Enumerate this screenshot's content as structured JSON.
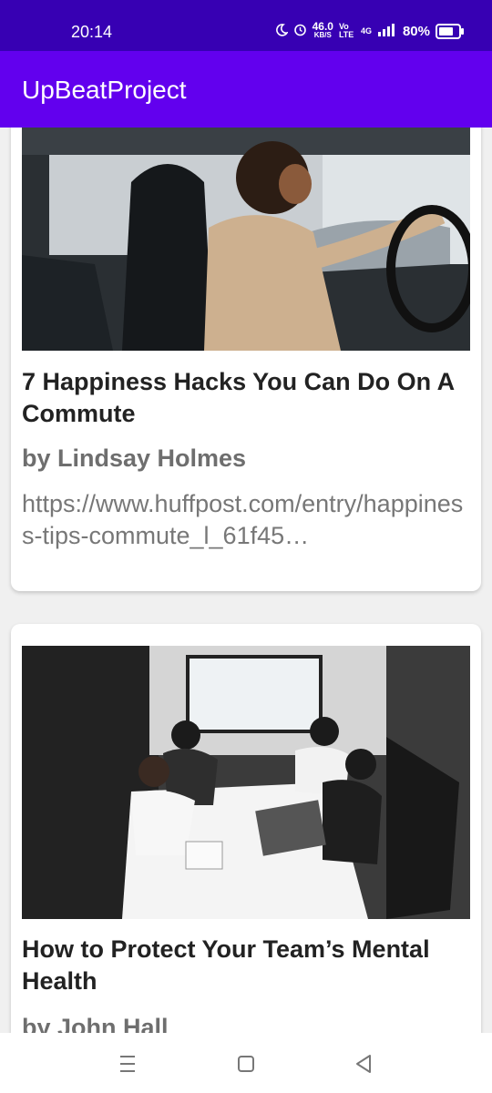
{
  "status_bar": {
    "time": "20:14",
    "net_speed": "46.0",
    "net_unit": "KB/S",
    "volte": "Vo LTE",
    "network": "4G",
    "battery": "80%"
  },
  "app_bar": {
    "title": "UpBeatProject"
  },
  "articles": [
    {
      "title": "7 Happiness Hacks You Can Do On A Commute",
      "author": "by Lindsay Holmes",
      "url": "https://www.huffpost.com/entry/happiness-tips-commute_l_61f45…",
      "image": "woman-driving-car-photo"
    },
    {
      "title": "How to Protect Your Team’s Mental Health",
      "author": "by John Hall",
      "image": "team-hands-together-meeting-photo"
    }
  ],
  "nav_bar": {
    "menu_icon": "recent-apps-icon",
    "home_icon": "home-icon",
    "back_icon": "back-icon"
  },
  "colors": {
    "status_bar": "#3700b3",
    "app_bar": "#6200ee",
    "title_text": "#222222",
    "author_text": "#6e6e6e"
  }
}
